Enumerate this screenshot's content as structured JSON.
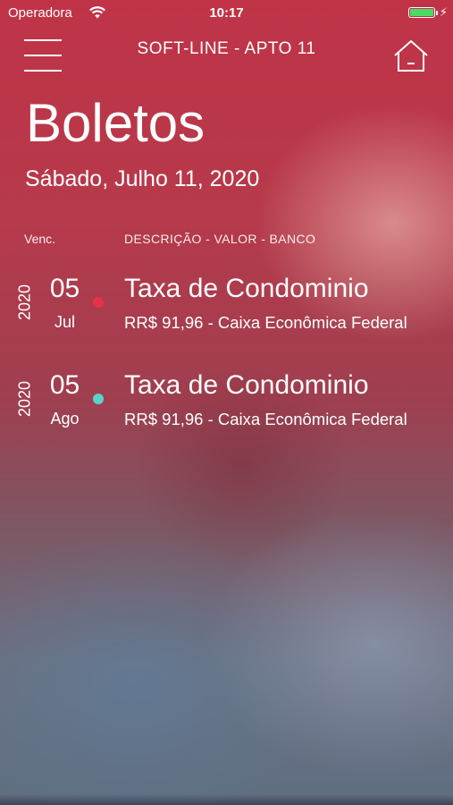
{
  "status_bar": {
    "carrier": "Operadora",
    "time": "10:17",
    "wifi_icon": "wifi-icon",
    "battery_icon": "battery-icon",
    "charging_icon": "bolt-icon",
    "battery_color": "#4cd964"
  },
  "nav": {
    "title": "SOFT-LINE - APTO 11",
    "menu_icon": "hamburger-menu-icon",
    "home_icon": "home-icon"
  },
  "page": {
    "title": "Boletos",
    "date": "Sábado, Julho 11, 2020"
  },
  "columns": {
    "due": "Venc.",
    "description": "DESCRIÇÃO - VALOR - BANCO"
  },
  "boletos": [
    {
      "year": "2020",
      "day": "05",
      "month": "Jul",
      "description": "Taxa de Condominio",
      "details": "RR$ 91,96 - Caixa Econômica Federal",
      "status_color": "#e8324a"
    },
    {
      "year": "2020",
      "day": "05",
      "month": "Ago",
      "description": "Taxa de Condominio",
      "details": "RR$ 91,96 - Caixa Econômica Federal",
      "status_color": "#5ad2cc"
    }
  ]
}
